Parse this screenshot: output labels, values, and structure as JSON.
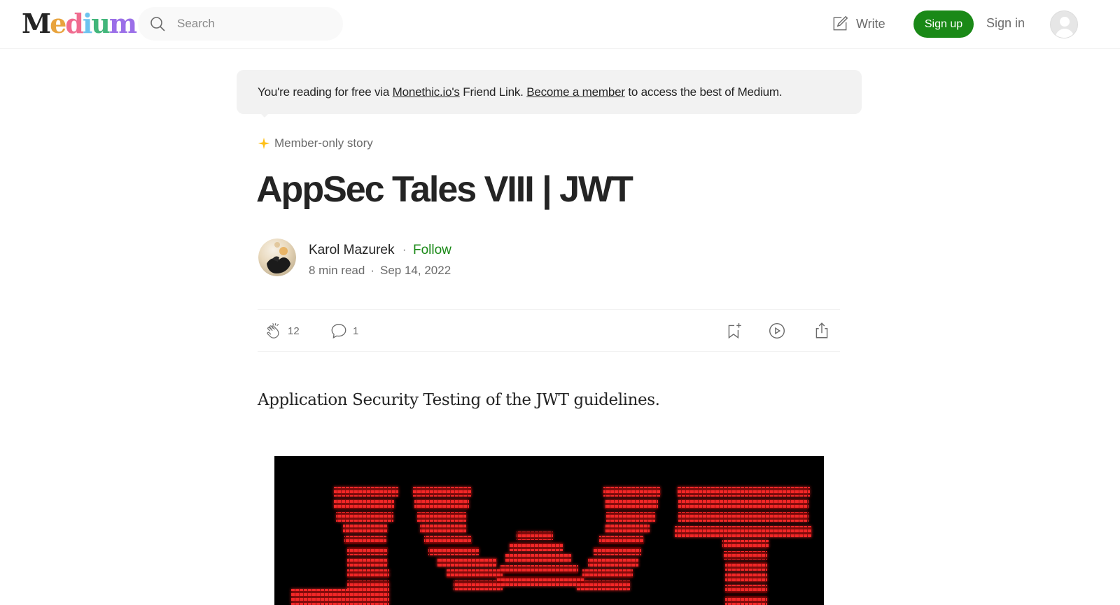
{
  "nav": {
    "logo_parts": [
      "M",
      "e",
      "d",
      "i",
      "u",
      "m"
    ],
    "search_placeholder": "Search",
    "write_label": "Write",
    "signup_label": "Sign up",
    "signin_label": "Sign in"
  },
  "banner": {
    "prefix": "You're reading for free via ",
    "friend_link": "Monethic.io's",
    "middle": " Friend Link. ",
    "member_link": "Become a member",
    "suffix": " to access the best of Medium."
  },
  "story": {
    "member_label": "Member-only story",
    "title": "AppSec Tales VIII | JWT",
    "subtitle": "Application Security Testing of the JWT guidelines."
  },
  "author": {
    "name": "Karol Mazurek",
    "dot": "·",
    "follow_label": "Follow",
    "read_time": "8 min read",
    "sep": "·",
    "date": "Sep 14, 2022"
  },
  "actions": {
    "claps": "12",
    "responses": "1"
  },
  "colors": {
    "accent_green": "#1a8917",
    "hero_red": "#e0161a",
    "member_star": "#ffc017"
  }
}
